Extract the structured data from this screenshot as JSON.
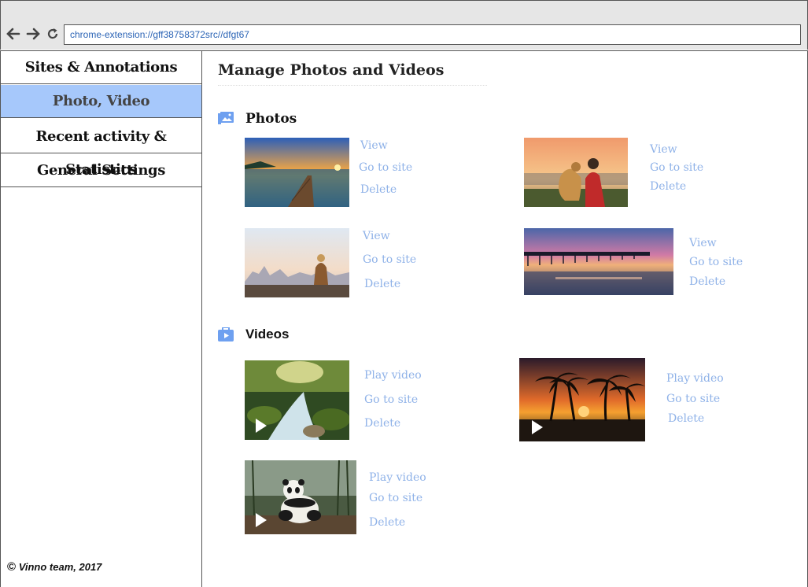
{
  "browser": {
    "url": "chrome-extension://gff38758372src//dfgt67"
  },
  "sidebar": {
    "items": [
      {
        "label": "Sites & Annotations"
      },
      {
        "label": "Photo, Video"
      },
      {
        "label": "Recent activity & Statistics"
      },
      {
        "label": "General Settings"
      }
    ],
    "active_index": 1,
    "footer": "Vinno team, 2017",
    "copyright_symbol": "©"
  },
  "main": {
    "title": "Manage Photos and Videos",
    "photos": {
      "heading": "Photos",
      "icon": "image-gallery-icon",
      "actions": {
        "view": "View",
        "go": "Go to site",
        "delete": "Delete"
      },
      "items": [
        {
          "scene": "sunset-pier-lake"
        },
        {
          "scene": "man-with-dog-sunset"
        },
        {
          "scene": "woman-overlooking-city"
        },
        {
          "scene": "pier-at-dusk"
        }
      ]
    },
    "videos": {
      "heading": "Videos",
      "icon": "video-case-icon",
      "actions": {
        "play": "Play video",
        "go": "Go to site",
        "delete": "Delete"
      },
      "items": [
        {
          "scene": "forest-stream"
        },
        {
          "scene": "palm-trees-sunset"
        },
        {
          "scene": "panda-in-forest"
        }
      ]
    }
  },
  "colors": {
    "accent": "#a6c8fb",
    "link": "#8fb2e8",
    "url_text": "#2a63b5",
    "section_icon": "#6ea0f0"
  }
}
